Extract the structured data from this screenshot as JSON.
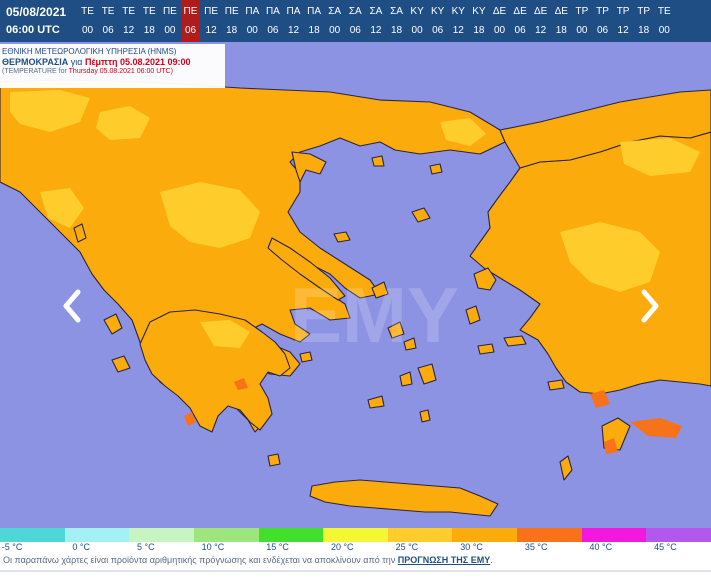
{
  "header": {
    "date": "05/08/2021",
    "utc": "06:00 UTC",
    "slots": [
      {
        "day": "ΤΕ",
        "hour": "00"
      },
      {
        "day": "ΤΕ",
        "hour": "06"
      },
      {
        "day": "ΤΕ",
        "hour": "12"
      },
      {
        "day": "ΤΕ",
        "hour": "18"
      },
      {
        "day": "ΠΕ",
        "hour": "00"
      },
      {
        "day": "ΠΕ",
        "hour": "06",
        "active": true
      },
      {
        "day": "ΠΕ",
        "hour": "12"
      },
      {
        "day": "ΠΕ",
        "hour": "18"
      },
      {
        "day": "ΠΑ",
        "hour": "00"
      },
      {
        "day": "ΠΑ",
        "hour": "06"
      },
      {
        "day": "ΠΑ",
        "hour": "12"
      },
      {
        "day": "ΠΑ",
        "hour": "18"
      },
      {
        "day": "ΣΑ",
        "hour": "00"
      },
      {
        "day": "ΣΑ",
        "hour": "06"
      },
      {
        "day": "ΣΑ",
        "hour": "12"
      },
      {
        "day": "ΣΑ",
        "hour": "18"
      },
      {
        "day": "ΚΥ",
        "hour": "00"
      },
      {
        "day": "ΚΥ",
        "hour": "06"
      },
      {
        "day": "ΚΥ",
        "hour": "12"
      },
      {
        "day": "ΚΥ",
        "hour": "18"
      },
      {
        "day": "ΔΕ",
        "hour": "00"
      },
      {
        "day": "ΔΕ",
        "hour": "06"
      },
      {
        "day": "ΔΕ",
        "hour": "12"
      },
      {
        "day": "ΔΕ",
        "hour": "18"
      },
      {
        "day": "ΤΡ",
        "hour": "00"
      },
      {
        "day": "ΤΡ",
        "hour": "06"
      },
      {
        "day": "ΤΡ",
        "hour": "12"
      },
      {
        "day": "ΤΡ",
        "hour": "18"
      },
      {
        "day": "ΤΕ",
        "hour": "00"
      }
    ]
  },
  "info": {
    "org": "ΕΘΝΙΚΗ ΜΕΤΕΩΡΟΛΟΓΙΚΗ ΥΠΗΡΕΣΙΑ (HNMS)",
    "title_main": "ΘΕΡΜΟΚΡΑΣΙΑ",
    "title_for": "για",
    "title_date": "Πέμπτη 05.08.2021 09:00",
    "sub_main": "(TEMPERATURE for",
    "sub_date": "Thursday 05.08.2021 06:00 UTC)"
  },
  "watermark": "ΕΜΥ",
  "legend": {
    "swatches": [
      "#4fd6d6",
      "#a3f0f5",
      "#c6f5c2",
      "#9fe57d",
      "#41e02c",
      "#f4f733",
      "#fecd2b",
      "#fcab0d",
      "#f8721a",
      "#f218e0",
      "#b258ef"
    ],
    "labels": [
      "-5 °C",
      "0 °C",
      "5 °C",
      "10 °C",
      "15 °C",
      "20 °C",
      "25 °C",
      "30 °C",
      "35 °C",
      "40 °C",
      "45 °C"
    ]
  },
  "colors": {
    "sea": "#8d93e3",
    "temp_30": "#fcab0d",
    "temp_25": "#fecd2b",
    "temp_35": "#f8721a",
    "header": "#1f4e85",
    "active_slot": "#b01c1c"
  },
  "footer": {
    "text": "Οι παραπάνω χάρτες είναι προϊόντα αριθμητικής πρόγνωσης και ενδέχεται να αποκλίνουν από την",
    "link": "ΠΡΟΓΝΩΣΗ ΤΗΣ ΕΜΥ",
    "end": "."
  },
  "icons": {
    "prev": "chevron-left-icon",
    "next": "chevron-right-icon"
  }
}
